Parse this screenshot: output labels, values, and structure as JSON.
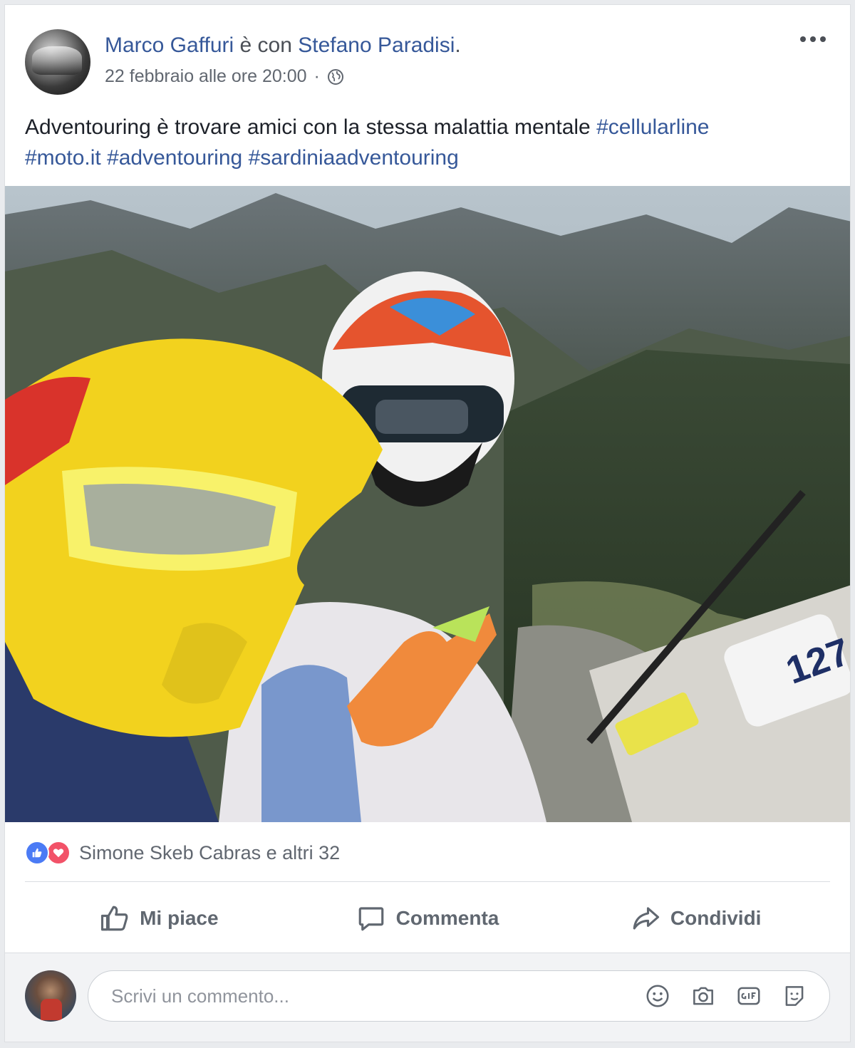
{
  "post": {
    "author": "Marco Gaffuri",
    "with_text": "è con",
    "tagged": "Stefano Paradisi",
    "tagged_suffix": ".",
    "timestamp": "22 febbraio alle ore 20:00",
    "separator": "·",
    "privacy_icon": "globe-icon",
    "more_icon": "more-options-icon",
    "text_plain": "Adventouring è trovare amici con la stessa malattia mentale ",
    "hashtags": [
      "#cellularline",
      "#moto.it",
      "#adventouring",
      "#sardiniaadventouring"
    ]
  },
  "reactions": {
    "icons": [
      "like-icon",
      "love-icon"
    ],
    "summary": "Simone Skeb Cabras e altri 32"
  },
  "actions": {
    "like": "Mi piace",
    "comment": "Commenta",
    "share": "Condividi"
  },
  "comment_box": {
    "placeholder": "Scrivi un commento...",
    "icons": [
      "emoji-icon",
      "camera-icon",
      "gif-icon",
      "sticker-icon"
    ]
  },
  "colors": {
    "link": "#365899",
    "like_blue": "#4b7bf5",
    "love_red": "#f25268",
    "muted": "#616770"
  }
}
